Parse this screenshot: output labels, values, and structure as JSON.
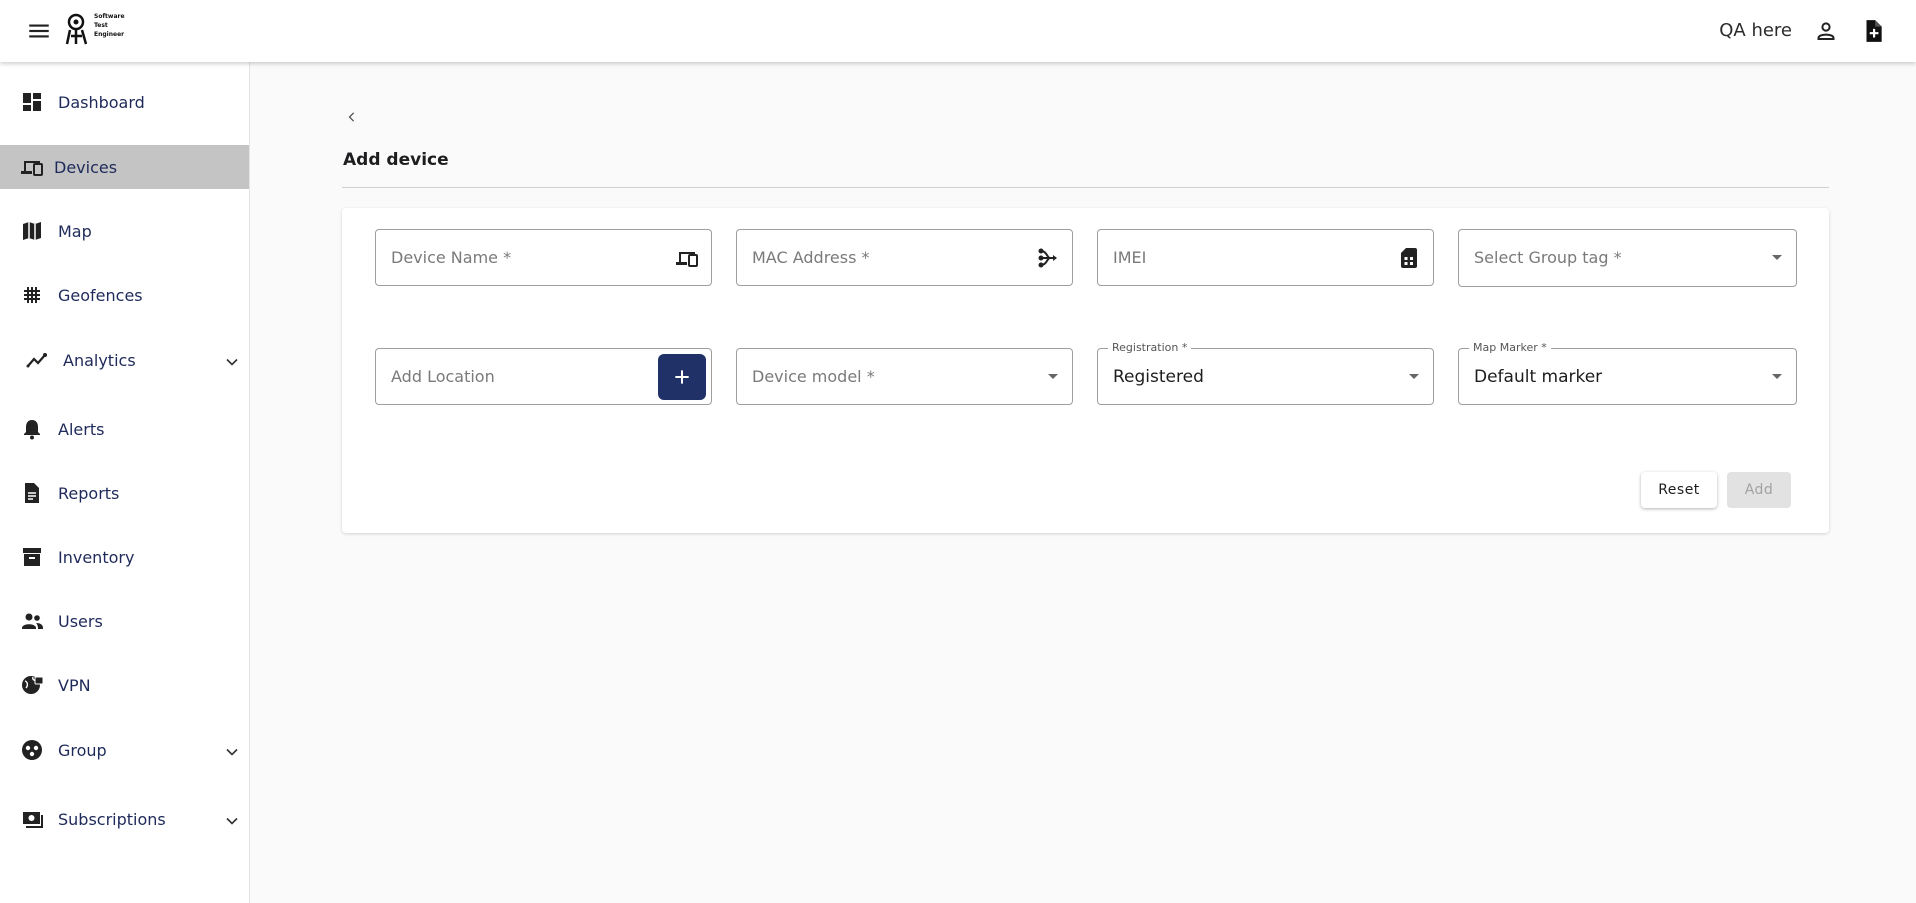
{
  "header": {
    "username": "QA here",
    "logo_text": [
      "Software",
      "Test",
      "Engineer"
    ]
  },
  "sidebar": {
    "items": [
      {
        "label": "Dashboard",
        "icon": "dashboard-icon"
      },
      {
        "label": "Devices",
        "icon": "devices-icon",
        "active": true
      },
      {
        "label": "Map",
        "icon": "map-icon"
      },
      {
        "label": "Geofences",
        "icon": "grid-icon"
      },
      {
        "label": "Analytics",
        "icon": "analytics-icon",
        "expandable": true
      },
      {
        "label": "Alerts",
        "icon": "bell-icon"
      },
      {
        "label": "Reports",
        "icon": "report-icon"
      },
      {
        "label": "Inventory",
        "icon": "archive-icon"
      },
      {
        "label": "Users",
        "icon": "users-icon"
      },
      {
        "label": "VPN",
        "icon": "globe-lock-icon"
      },
      {
        "label": "Group",
        "icon": "group-icon",
        "expandable": true
      },
      {
        "label": "Subscriptions",
        "icon": "subscriptions-icon",
        "expandable": true
      }
    ]
  },
  "page": {
    "title": "Add device"
  },
  "form": {
    "device_name": {
      "placeholder": "Device Name *",
      "icon": "devices-icon"
    },
    "mac_address": {
      "placeholder": "MAC Address *",
      "icon": "network-branch-icon"
    },
    "imei": {
      "placeholder": "IMEI",
      "icon": "sim-card-icon"
    },
    "group_tag": {
      "placeholder": "Select Group tag *"
    },
    "location": {
      "placeholder": "Add Location",
      "button_icon": "plus-icon"
    },
    "device_model": {
      "placeholder": "Device model *"
    },
    "registration": {
      "label": "Registration *",
      "value": "Registered"
    },
    "map_marker": {
      "label": "Map Marker *",
      "value": "Default marker"
    },
    "reset_label": "Reset",
    "add_label": "Add"
  },
  "colors": {
    "accent": "#1f3167",
    "active_nav": "#c4c4c4",
    "nav_text": "#1e2a5a"
  }
}
